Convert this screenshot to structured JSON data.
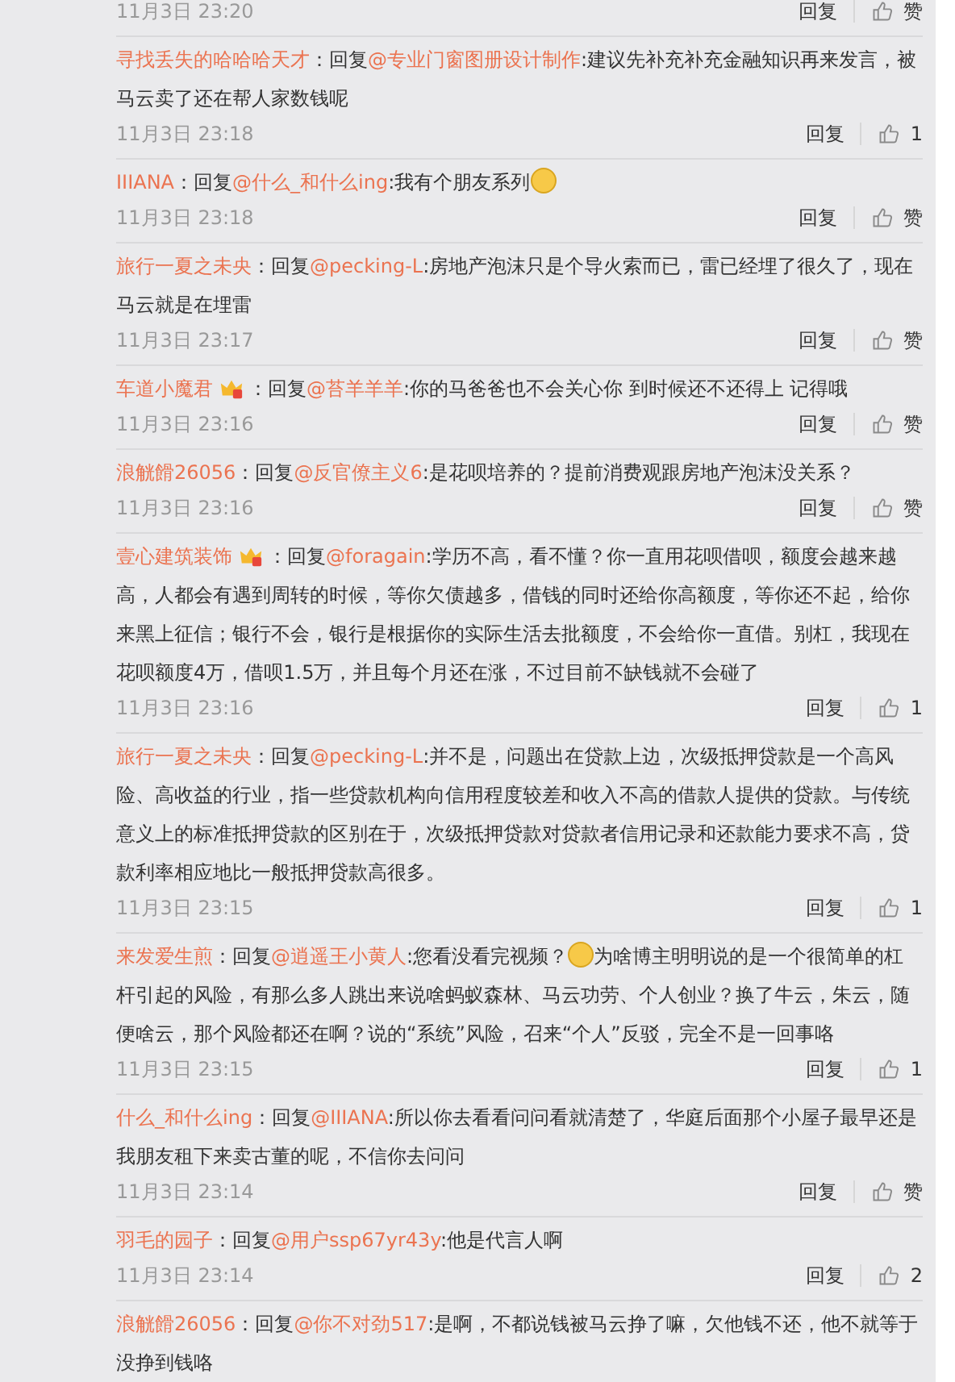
{
  "top_meta": {
    "time": "11月3日 23:20",
    "reply": "回复",
    "like": "赞"
  },
  "comments": [
    {
      "user": "寻找丢失的哈哈哈天才",
      "badge": false,
      "prefix": "：回复",
      "mention": "@专业门窗图册设计制作",
      "text": [
        {
          "kind": "text",
          "value": ":建议先补充补充金融知识再来发言，被马云卖了还在帮人家数钱呢"
        }
      ],
      "time": "11月3日 23:18",
      "reply": "回复",
      "like": "1"
    },
    {
      "user": "IIIANA",
      "badge": false,
      "prefix": "：回复",
      "mention": "@什么_和什么ing",
      "text": [
        {
          "kind": "text",
          "value": ":我有个朋友系列"
        },
        {
          "kind": "emoji"
        }
      ],
      "time": "11月3日 23:18",
      "reply": "回复",
      "like": "赞"
    },
    {
      "user": "旅行一夏之未央",
      "badge": false,
      "prefix": "：回复",
      "mention": "@pecking-L",
      "text": [
        {
          "kind": "text",
          "value": ":房地产泡沫只是个导火索而已，雷已经埋了很久了，现在马云就是在埋雷"
        }
      ],
      "time": "11月3日 23:17",
      "reply": "回复",
      "like": "赞"
    },
    {
      "user": "车道小魔君",
      "badge": true,
      "prefix": "：回复",
      "mention": "@苔羊羊羊",
      "text": [
        {
          "kind": "text",
          "value": ":你的马爸爸也不会关心你 到时候还不还得上 记得哦"
        }
      ],
      "time": "11月3日 23:16",
      "reply": "回复",
      "like": "赞"
    },
    {
      "user": "浪觥餶26056",
      "badge": false,
      "prefix": "：回复",
      "mention": "@反官僚主义6",
      "text": [
        {
          "kind": "text",
          "value": ":是花呗培养的？提前消费观跟房地产泡沫没关系？"
        }
      ],
      "time": "11月3日 23:16",
      "reply": "回复",
      "like": "赞"
    },
    {
      "user": "壹心建筑装饰",
      "badge": true,
      "prefix": "：回复",
      "mention": "@foragain",
      "text": [
        {
          "kind": "text",
          "value": ":学历不高，看不懂？你一直用花呗借呗，额度会越来越高，人都会有遇到周转的时候，等你欠债越多，借钱的同时还给你高额度，等你还不起，给你来黑上征信；银行不会，银行是根据你的实际生活去批额度，不会给你一直借。别杠，我现在花呗额度4万，借呗1.5万，并且每个月还在涨，不过目前不缺钱就不会碰了"
        }
      ],
      "time": "11月3日 23:16",
      "reply": "回复",
      "like": "1"
    },
    {
      "user": "旅行一夏之未央",
      "badge": false,
      "prefix": "：回复",
      "mention": "@pecking-L",
      "text": [
        {
          "kind": "text",
          "value": ":并不是，问题出在贷款上边，次级抵押贷款是一个高风险、高收益的行业，指一些贷款机构向信用程度较差和收入不高的借款人提供的贷款。与传统意义上的标准抵押贷款的区别在于，次级抵押贷款对贷款者信用记录和还款能力要求不高，贷款利率相应地比一般抵押贷款高很多。"
        }
      ],
      "time": "11月3日 23:15",
      "reply": "回复",
      "like": "1"
    },
    {
      "user": "来发爱生煎",
      "badge": false,
      "prefix": "：回复",
      "mention": "@逍遥王小黄人",
      "text": [
        {
          "kind": "text",
          "value": ":您看没看完视频？"
        },
        {
          "kind": "emoji"
        },
        {
          "kind": "text",
          "value": "为啥博主明明说的是一个很简单的杠杆引起的风险，有那么多人跳出来说啥蚂蚁森林、马云功劳、个人创业？换了牛云，朱云，随便啥云，那个风险都还在啊？说的“系统”风险，召来“个人”反驳，完全不是一回事咯"
        }
      ],
      "time": "11月3日 23:15",
      "reply": "回复",
      "like": "1"
    },
    {
      "user": "什么_和什么ing",
      "badge": false,
      "prefix": "：回复",
      "mention": "@IIIANA",
      "text": [
        {
          "kind": "text",
          "value": ":所以你去看看问问看就清楚了，华庭后面那个小屋子最早还是我朋友租下来卖古董的呢，不信你去问问"
        }
      ],
      "time": "11月3日 23:14",
      "reply": "回复",
      "like": "赞"
    },
    {
      "user": "羽毛的园子",
      "badge": false,
      "prefix": "：回复",
      "mention": "@用户ssp67yr43y",
      "text": [
        {
          "kind": "text",
          "value": ":他是代言人啊"
        }
      ],
      "time": "11月3日 23:14",
      "reply": "回复",
      "like": "2"
    },
    {
      "user": "浪觥餶26056",
      "badge": false,
      "prefix": "：回复",
      "mention": "@你不对劲517",
      "text": [
        {
          "kind": "text",
          "value": ":是啊，不都说钱被马云挣了嘛，欠他钱不还，他不就等于没挣到钱咯"
        }
      ]
    }
  ]
}
